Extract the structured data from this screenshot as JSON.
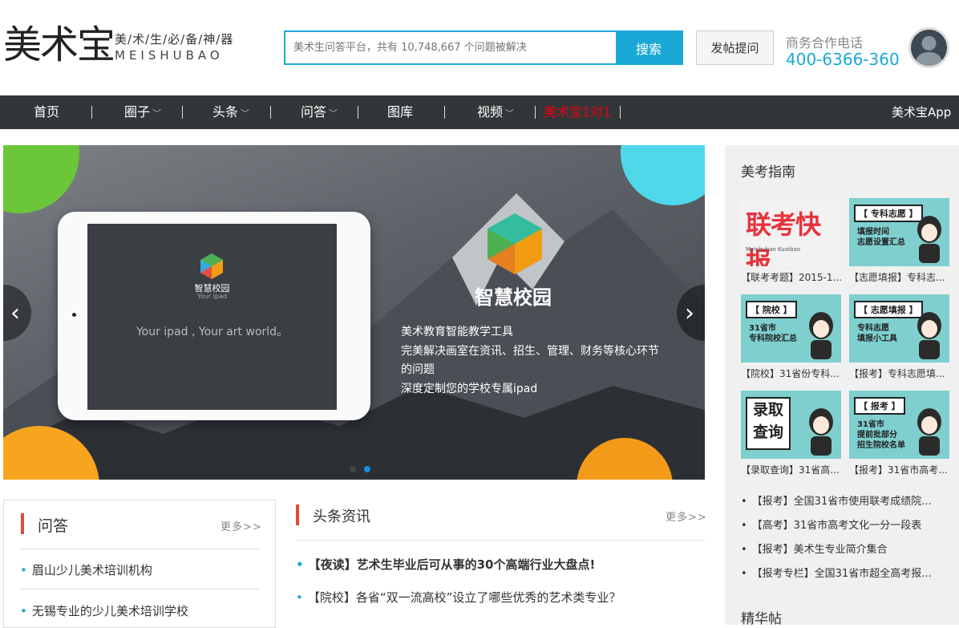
{
  "header": {
    "logo_text": "美术宝",
    "logo_tagline": "美/术/生/必/备/神/器",
    "logo_pinyin": "MEISHUBAO",
    "search_placeholder": "美术生问答平台，共有 10,748,667 个问题被解决",
    "search_button": "搜索",
    "post_button": "发帖提问",
    "biz_label": "商务合作电话",
    "biz_phone": "400-6366-360"
  },
  "nav": {
    "items": [
      "首页",
      "圈子",
      "头条",
      "问答",
      "图库",
      "视频",
      "美术宝1对1"
    ],
    "app_link": "美术宝App",
    "highlight_color": "#e60012"
  },
  "banner": {
    "title": "智慧校园",
    "lines": [
      "美术教育智能教学工具",
      "完美解决画室在资讯、招生、管理、财务等核心环节的问题",
      "深度定制您的学校专属ipad"
    ],
    "ipad_logo": "智慧校园",
    "ipad_sub": "Your ipad",
    "ipad_slogan": "Your ipad , Your art world。",
    "active_dot": 2
  },
  "qa": {
    "title": "问答",
    "more": "更多>>",
    "items": [
      "眉山少儿美术培训机构",
      "无锡专业的少儿美术培训学校"
    ]
  },
  "news": {
    "title": "头条资讯",
    "more": "更多>>",
    "items": [
      "【夜读】艺术生毕业后可从事的30个高端行业大盘点!",
      "【院校】各省“双一流高校”设立了哪些优秀的艺术类专业？"
    ]
  },
  "sidebar": {
    "title": "美考指南",
    "cards": [
      {
        "caption": "【联考考题】2015-1...",
        "label": "联考快报",
        "sub": "Meishubao Kuaibao"
      },
      {
        "caption": "【志愿填报】专科志...",
        "label": "【 专科志愿 】",
        "sub": "填报时间\n志愿设置汇总"
      },
      {
        "caption": "【院校】31省份专科...",
        "label": "【 院校 】",
        "sub": "31省市\n专科院校汇总"
      },
      {
        "caption": "【报考】专科志愿填...",
        "label": "【 志愿填报 】",
        "sub": "专科志愿\n填报小工具"
      },
      {
        "caption": "【录取查询】31省高...",
        "label": "录取\n查询",
        "sub": ""
      },
      {
        "caption": "【报考】31省市高考...",
        "label": "【 报考 】",
        "sub": "31省市\n提前批部分\n招生院校名单"
      }
    ],
    "list": [
      "【报考】全国31省市使用联考成绩院...",
      "【高考】31省市高考文化一分一段表",
      "【报考】美术生专业简介集合",
      "【报考专栏】全国31省市超全高考报..."
    ],
    "section2_title": "精华帖"
  }
}
